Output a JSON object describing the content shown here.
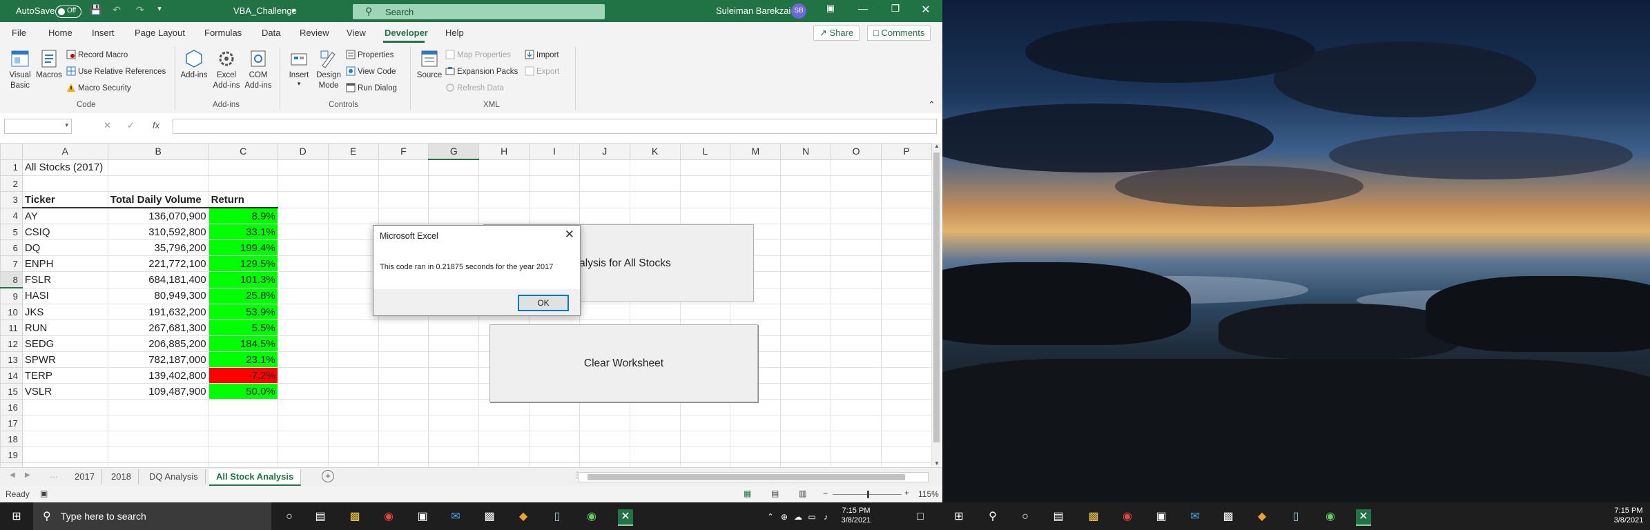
{
  "titlebar": {
    "autosave_label": "AutoSave",
    "autosave_state": "Off",
    "filename": "VBA_Challenge",
    "filename_caret": "▾",
    "search_placeholder": "Search",
    "user_name": "Suleiman Barekzai",
    "user_initials": "SB"
  },
  "menu": {
    "tabs": [
      "File",
      "Home",
      "Insert",
      "Page Layout",
      "Formulas",
      "Data",
      "Review",
      "View",
      "Developer",
      "Help"
    ],
    "share_label": "Share",
    "comments_label": "Comments"
  },
  "ribbon": {
    "code": {
      "visual_basic": "Visual Basic",
      "macros": "Macros",
      "record_macro": "Record Macro",
      "use_relative": "Use Relative References",
      "macro_security": "Macro Security",
      "group_label": "Code"
    },
    "addins": {
      "addins": "Add-ins",
      "excel_addins": "Excel Add-ins",
      "com_addins": "COM Add-ins",
      "group_label": "Add-ins"
    },
    "controls": {
      "insert": "Insert",
      "design_mode": "Design Mode",
      "properties": "Properties",
      "view_code": "View Code",
      "run_dialog": "Run Dialog",
      "group_label": "Controls"
    },
    "xml": {
      "source": "Source",
      "map_properties": "Map Properties",
      "expansion_packs": "Expansion Packs",
      "refresh_data": "Refresh Data",
      "import": "Import",
      "export": "Export",
      "group_label": "XML"
    }
  },
  "formula_bar": {
    "fx_label": "fx",
    "value": ""
  },
  "grid": {
    "columns": [
      "A",
      "B",
      "C",
      "D",
      "E",
      "F",
      "G",
      "H",
      "I",
      "J",
      "K",
      "L",
      "M",
      "N",
      "O",
      "P"
    ],
    "title": "All Stocks (2017)",
    "headers": [
      "Ticker",
      "Total Daily Volume",
      "Return"
    ],
    "rows": [
      {
        "ticker": "AY",
        "volume": "136,070,900",
        "ret": "8.9%",
        "status": "positive"
      },
      {
        "ticker": "CSIQ",
        "volume": "310,592,800",
        "ret": "33.1%",
        "status": "positive"
      },
      {
        "ticker": "DQ",
        "volume": "35,796,200",
        "ret": "199.4%",
        "status": "positive"
      },
      {
        "ticker": "ENPH",
        "volume": "221,772,100",
        "ret": "129.5%",
        "status": "positive"
      },
      {
        "ticker": "FSLR",
        "volume": "684,181,400",
        "ret": "101.3%",
        "status": "positive"
      },
      {
        "ticker": "HASI",
        "volume": "80,949,300",
        "ret": "25.8%",
        "status": "positive"
      },
      {
        "ticker": "JKS",
        "volume": "191,632,200",
        "ret": "53.9%",
        "status": "positive"
      },
      {
        "ticker": "RUN",
        "volume": "267,681,300",
        "ret": "5.5%",
        "status": "positive"
      },
      {
        "ticker": "SEDG",
        "volume": "206,885,200",
        "ret": "184.5%",
        "status": "positive"
      },
      {
        "ticker": "SPWR",
        "volume": "782,187,000",
        "ret": "23.1%",
        "status": "positive"
      },
      {
        "ticker": "TERP",
        "volume": "139,402,800",
        "ret": "-7.2%",
        "status": "negative"
      },
      {
        "ticker": "VSLR",
        "volume": "109,487,900",
        "ret": "50.0%",
        "status": "positive"
      }
    ],
    "colors": {
      "positive": "#00ff00",
      "negative": "#ff0000"
    }
  },
  "buttons": {
    "analysis": "Analysis for All Stocks",
    "clear": "Clear Worksheet"
  },
  "dialog": {
    "title": "Microsoft Excel",
    "message": "This code ran in 0.21875 seconds for the year 2017",
    "ok_label": "OK"
  },
  "sheets": {
    "tabs": [
      "2017",
      "2018",
      "DQ Analysis",
      "All Stock Analysis"
    ],
    "active": "All Stock Analysis"
  },
  "status": {
    "ready": "Ready",
    "zoom": "115%"
  },
  "taskbar": {
    "search_placeholder": "Type here to search",
    "left_time": "7:15 PM",
    "left_date": "3/8/2021",
    "right_time": "7:15 PM",
    "right_date": "3/8/2021"
  },
  "accent_color": "#217346"
}
